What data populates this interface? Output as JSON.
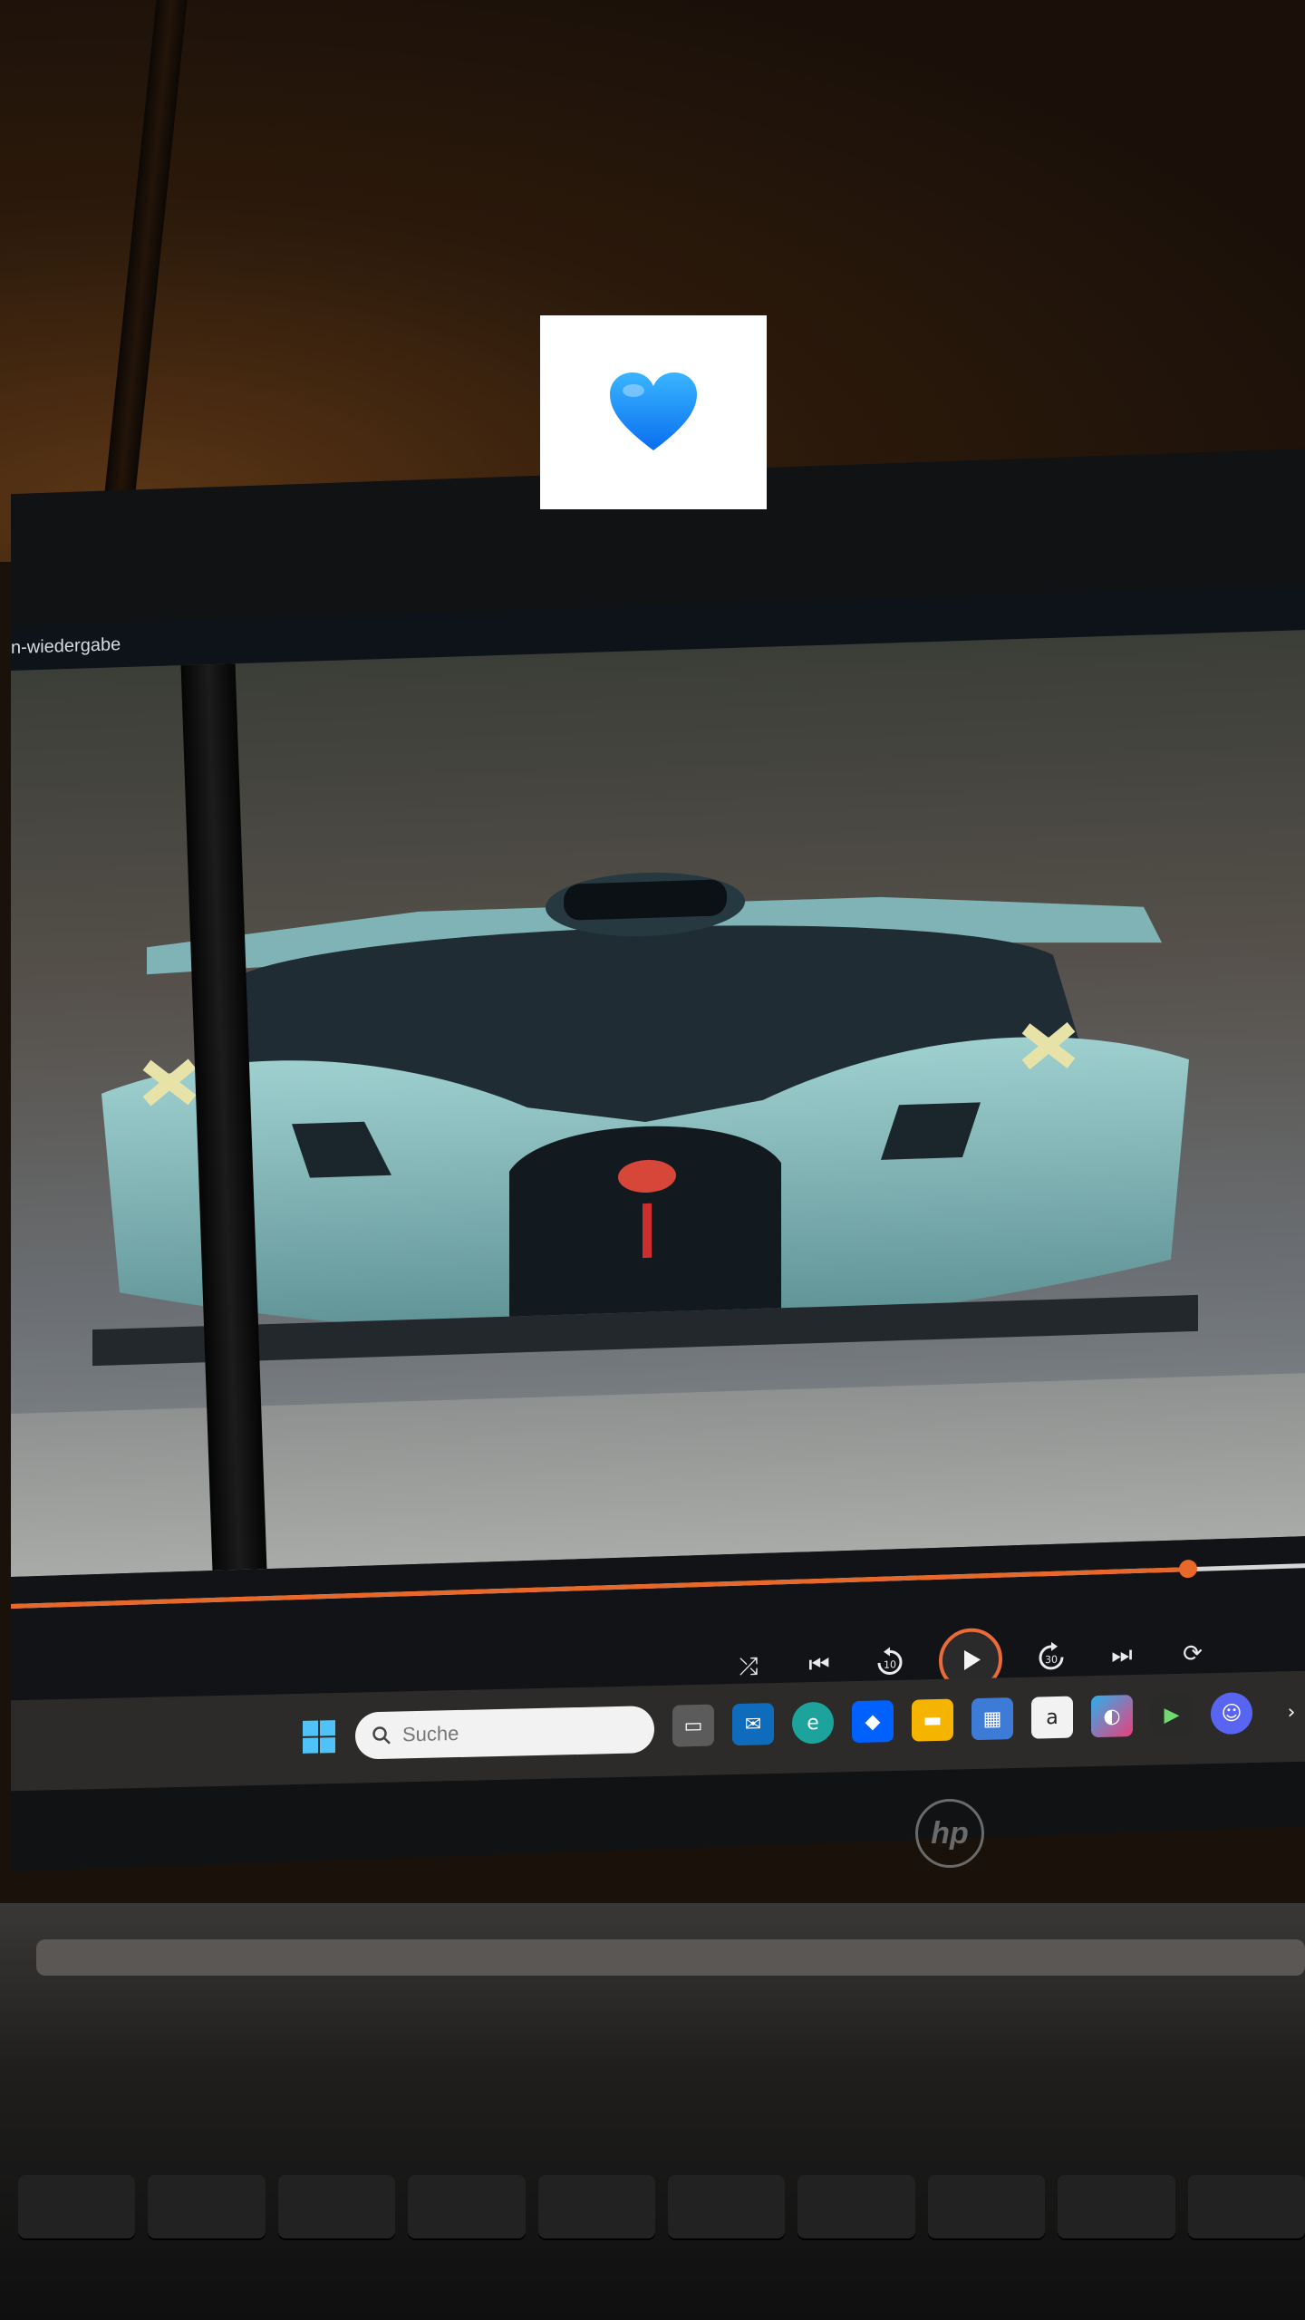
{
  "window": {
    "title": "n-wiedergabe"
  },
  "video": {
    "progress": 0.91
  },
  "controls": {
    "shuffle": "⤮",
    "previous": "⏮",
    "rewind": "10",
    "forward": "30",
    "next": "⏭",
    "repeat": "⟳"
  },
  "taskbar": {
    "search_placeholder": "Suche",
    "icons": [
      "task-view",
      "outlook",
      "edge",
      "dropbox",
      "file-explorer",
      "store",
      "amazon",
      "m365",
      "play",
      "discord",
      "chevron"
    ]
  },
  "sticker": {
    "emoji": "💙"
  },
  "colors": {
    "accent": "#e8682a",
    "heart": "#1e90ff",
    "taskbar": "#2c2b29"
  },
  "brand": {
    "laptop": "hp"
  }
}
